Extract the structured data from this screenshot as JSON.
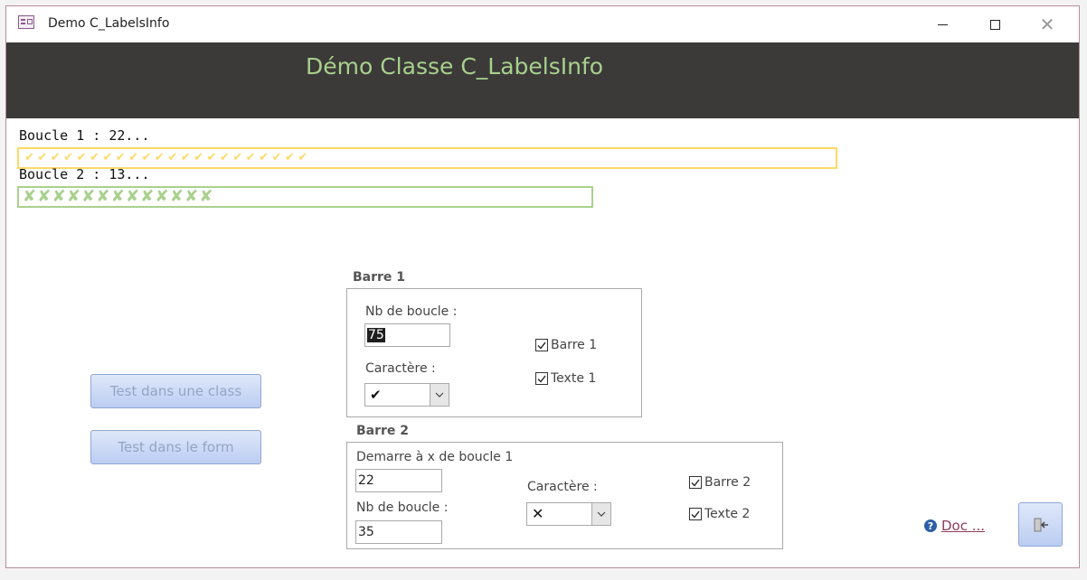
{
  "window": {
    "title": "Demo C_LabelsInfo"
  },
  "header": {
    "title": "Démo Classe C_LabelsInfo"
  },
  "progress": {
    "boucle1_label": "Boucle 1 : 22...",
    "boucle1_bar": "✔✔✔✔✔✔✔✔✔✔✔✔✔✔✔✔✔✔✔✔✔✔",
    "boucle1_color": "#ffd966",
    "boucle2_label": "Boucle 2 : 13...",
    "boucle2_bar": "✘✘✘✘✘✘✘✘✘✘✘✘✘",
    "boucle2_color": "#a9d18e"
  },
  "barre1": {
    "title": "Barre 1",
    "nb_boucle_label": "Nb de boucle :",
    "nb_boucle_value": "75",
    "caractere_label": "Caractère :",
    "caractere_value": "✔",
    "chk_barre_label": "Barre 1",
    "chk_barre_checked": true,
    "chk_texte_label": "Texte 1",
    "chk_texte_checked": true
  },
  "barre2": {
    "title": "Barre 2",
    "demarre_label": "Demarre à x de boucle 1",
    "demarre_value": "22",
    "nb_boucle_label": "Nb de boucle :",
    "nb_boucle_value": "35",
    "caractere_label": "Caractère :",
    "caractere_value": "✕",
    "chk_barre_label": "Barre 2",
    "chk_barre_checked": true,
    "chk_texte_label": "Texte 2",
    "chk_texte_checked": true
  },
  "buttons": {
    "test_class": "Test dans une class",
    "test_form": "Test dans le form",
    "doc": "Doc ..."
  },
  "icons": {
    "app": "form-icon",
    "help": "help-icon",
    "exit": "exit-door-icon"
  }
}
